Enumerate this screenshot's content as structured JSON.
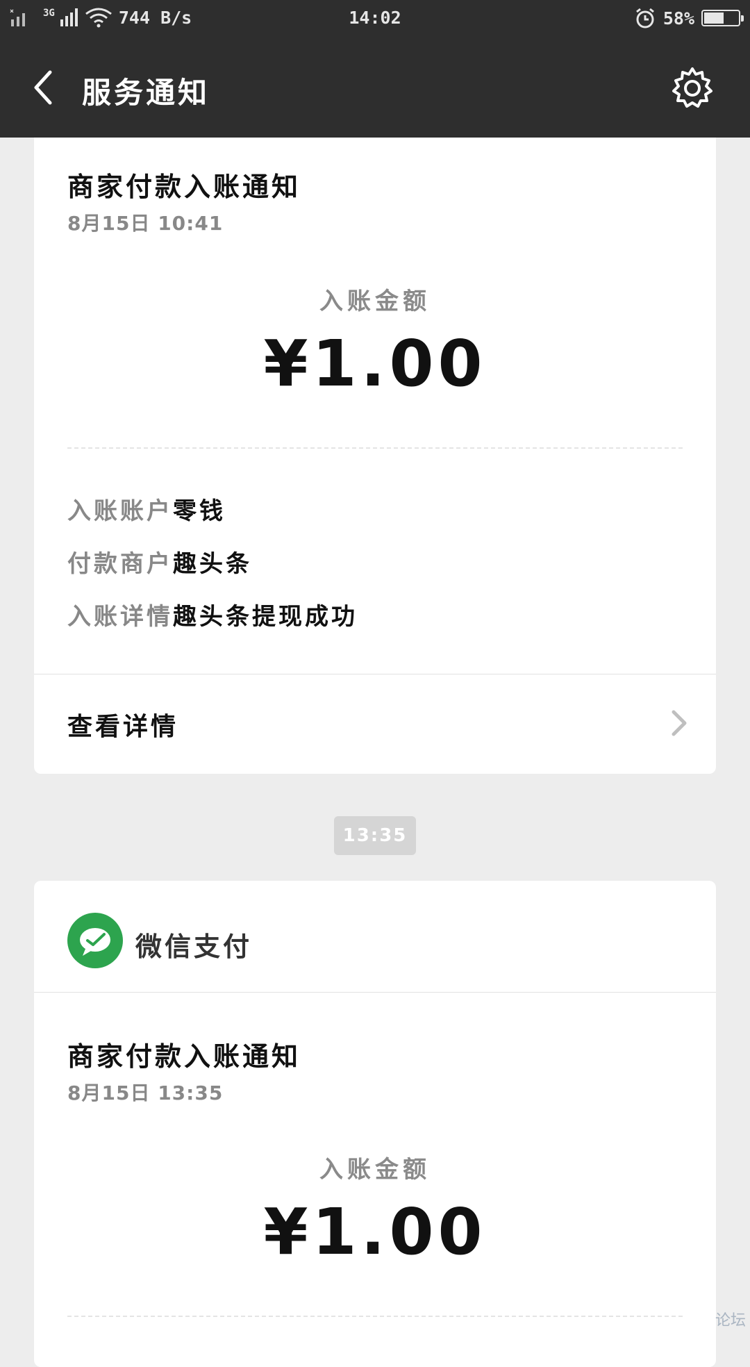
{
  "status_bar": {
    "signal_text": "3G",
    "network_speed": "744 B/s",
    "time": "14:02",
    "battery_percent": "58%",
    "battery_level": 0.58
  },
  "header": {
    "title": "服务通知"
  },
  "notifications": [
    {
      "title": "商家付款入账通知",
      "time": "8月15日  10:41",
      "amount_label": "入账金额",
      "amount": "¥1.00",
      "rows": [
        {
          "key": "入账账户",
          "value": "零钱"
        },
        {
          "key": "付款商户",
          "value": "趣头条"
        },
        {
          "key": "入账详情",
          "value": "趣头条提现成功"
        }
      ],
      "details_label": "查看详情"
    },
    {
      "source_name": "微信支付",
      "title": "商家付款入账通知",
      "time": "8月15日  13:35",
      "amount_label": "入账金额",
      "amount": "¥1.00"
    }
  ],
  "separator_time": "13:35",
  "watermark": "论坛",
  "colors": {
    "bar_bg": "#2e2e2e",
    "page_bg": "#ededed",
    "wechat_green": "#2da44e"
  },
  "icons": {
    "back": "chevron-left-icon",
    "settings": "gear-icon",
    "wechat_pay": "wechat-pay-logo-icon",
    "detail": "chevron-right-icon"
  }
}
